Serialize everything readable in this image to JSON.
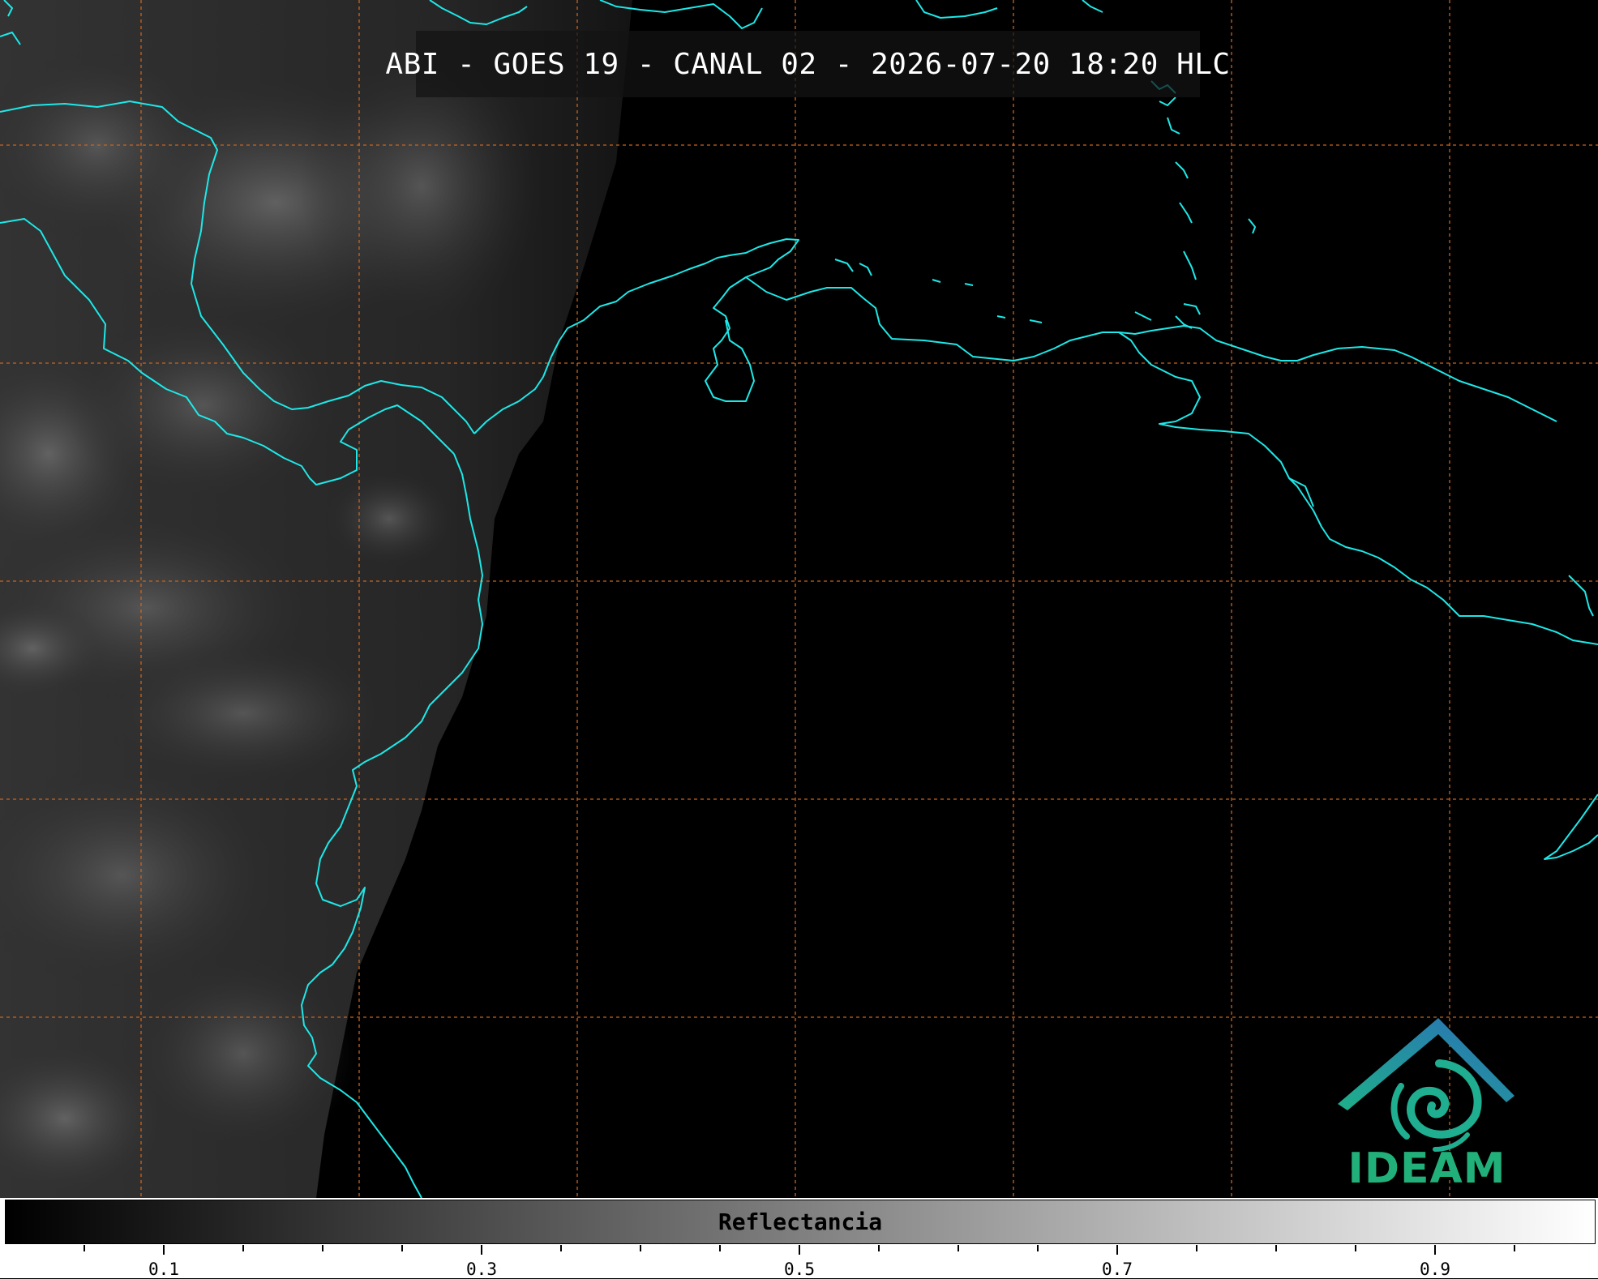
{
  "title": "ABI - GOES 19 - CANAL 02 - 2026-07-20 18:20 HLC",
  "logo_text": "IDEAM",
  "colorbar": {
    "label": "Reflectancia",
    "range": [
      0.0,
      1.0
    ],
    "major_ticks": [
      "0.1",
      "0.3",
      "0.5",
      "0.7",
      "0.9"
    ],
    "colors": {
      "start": "#000000",
      "end": "#ffffff"
    }
  },
  "colors": {
    "coastline": "#1ee8e8",
    "gridlines": "#c8641e",
    "logo_blue": "#2a6fb8",
    "logo_green": "#22b07a"
  }
}
